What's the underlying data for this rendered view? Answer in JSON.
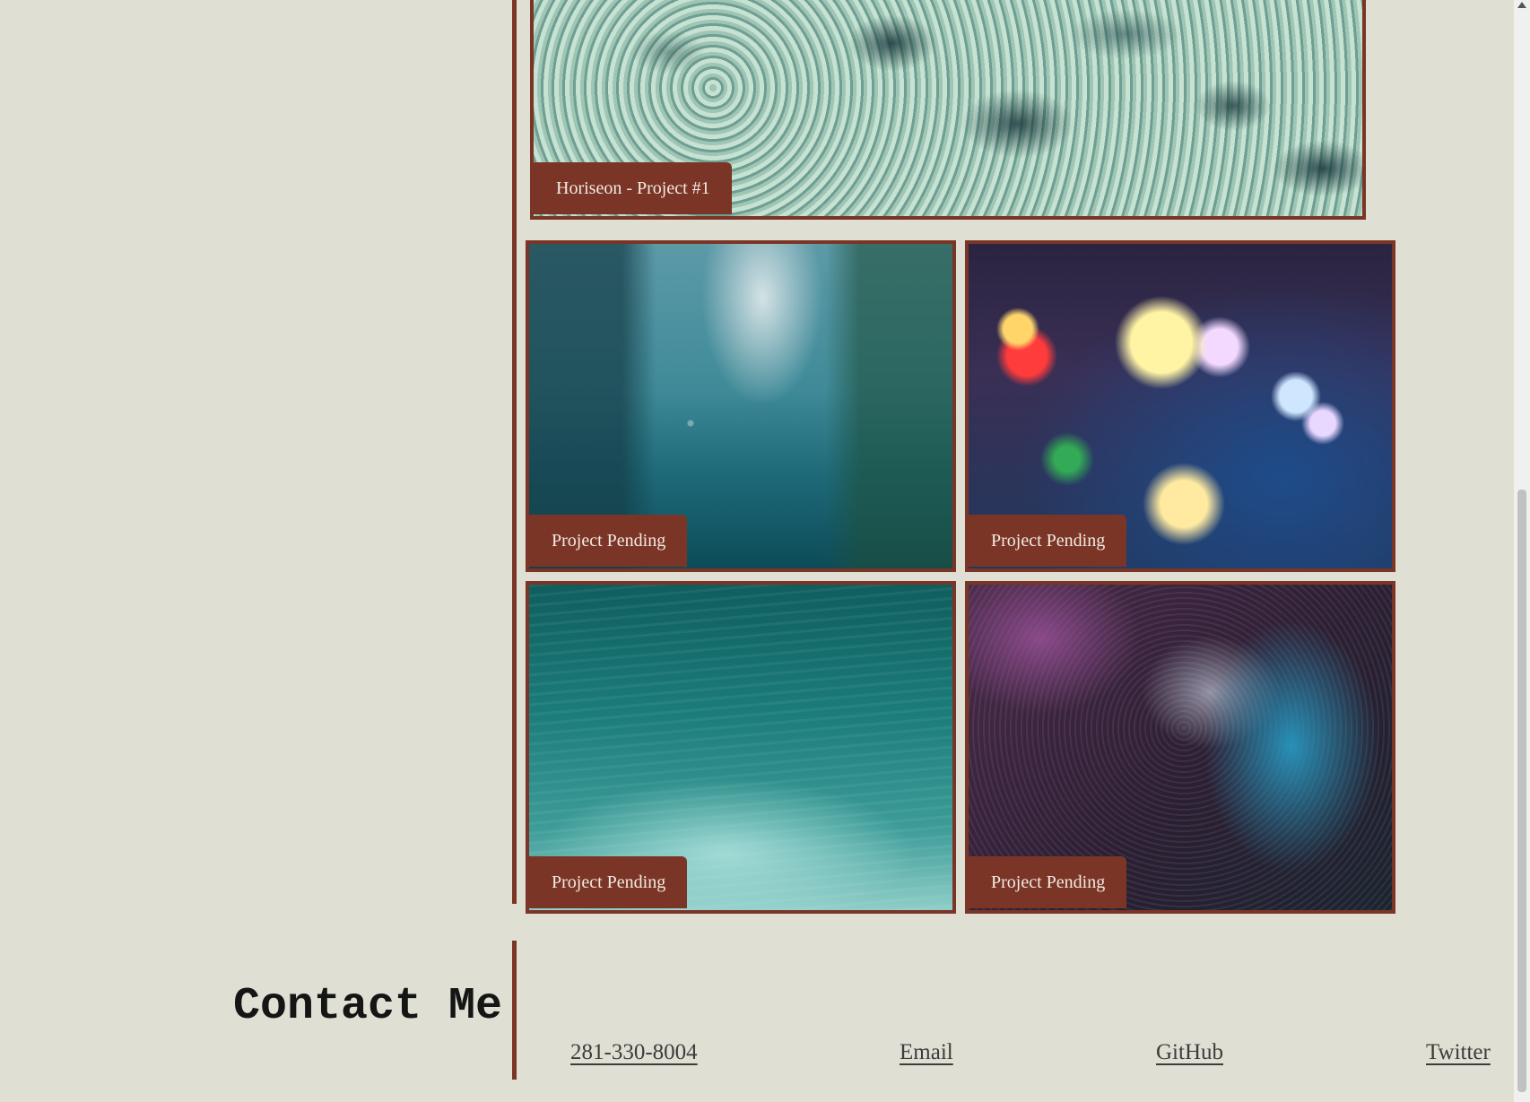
{
  "portfolio": {
    "featured": {
      "label": "Horiseon - Project #1",
      "image": "ocean-foam-image"
    },
    "projects": [
      {
        "label": "Project Pending",
        "image": "rainy-city-street-image"
      },
      {
        "label": "Project Pending",
        "image": "bokeh-lights-rain-image"
      },
      {
        "label": "Project Pending",
        "image": "teal-water-ripples-image"
      },
      {
        "label": "Project Pending",
        "image": "purple-blue-droplets-image"
      }
    ]
  },
  "contact": {
    "title": "Contact Me",
    "links": {
      "phone": "281-330-8004",
      "email": "Email",
      "github": "GitHub",
      "twitter": "Twitter"
    }
  },
  "colors": {
    "background": "#e0dfd3",
    "accent": "#7b3526",
    "label_text": "#f1ebe3",
    "link_text": "#3c3c3c"
  }
}
